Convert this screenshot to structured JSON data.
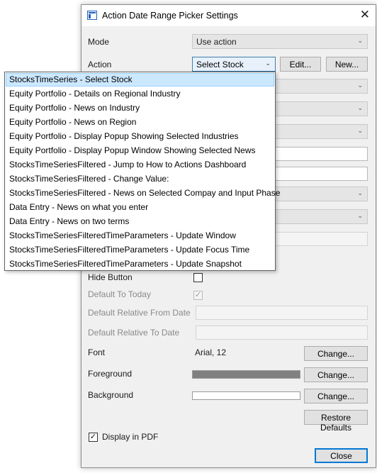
{
  "dialog": {
    "title": "Action Date Range Picker Settings",
    "close_glyph": "✕"
  },
  "form": {
    "mode_label": "Mode",
    "mode_value": "Use action",
    "action_label": "Action",
    "action_value": "Select Stock",
    "edit_button": "Edit...",
    "new_button": "New...",
    "hide_button_label": "Hide Button",
    "default_today_label": "Default To Today",
    "default_today_checked": true,
    "default_rel_from_label": "Default Relative From Date",
    "default_rel_to_label": "Default Relative To Date",
    "font_label": "Font",
    "font_value": "Arial, 12",
    "font_change": "Change...",
    "foreground_label": "Foreground",
    "foreground_color": "#808080",
    "foreground_change": "Change...",
    "background_label": "Background",
    "background_color": "#ffffff",
    "background_change": "Change...",
    "restore_defaults": "Restore Defaults",
    "display_pdf_label": "Display in PDF",
    "display_pdf_checked": true,
    "close_button": "Close"
  },
  "dropdown": {
    "selected_index": 0,
    "items": [
      "StocksTimeSeries - Select Stock",
      "Equity Portfolio - Details on Regional Industry",
      "Equity Portfolio - News on Industry",
      "Equity Portfolio - News on Region",
      "Equity Portfolio - Display Popup Showing Selected Industries",
      "Equity Portfolio - Display Popup Window Showing Selected News",
      "StocksTimeSeriesFiltered - Jump to How to Actions Dashboard",
      "StocksTimeSeriesFiltered - Change Value:",
      "StocksTimeSeriesFiltered - News on Selected Compay and Input Phase",
      "Data Entry - News on what you enter",
      "Data Entry - News on two terms",
      "StocksTimeSeriesFilteredTimeParameters - Update Window",
      "StocksTimeSeriesFilteredTimeParameters - Update Focus Time",
      "StocksTimeSeriesFilteredTimeParameters - Update Snapshot"
    ]
  },
  "icons": {
    "dropdown_arrow": "⌄",
    "check_mark": "✓"
  }
}
